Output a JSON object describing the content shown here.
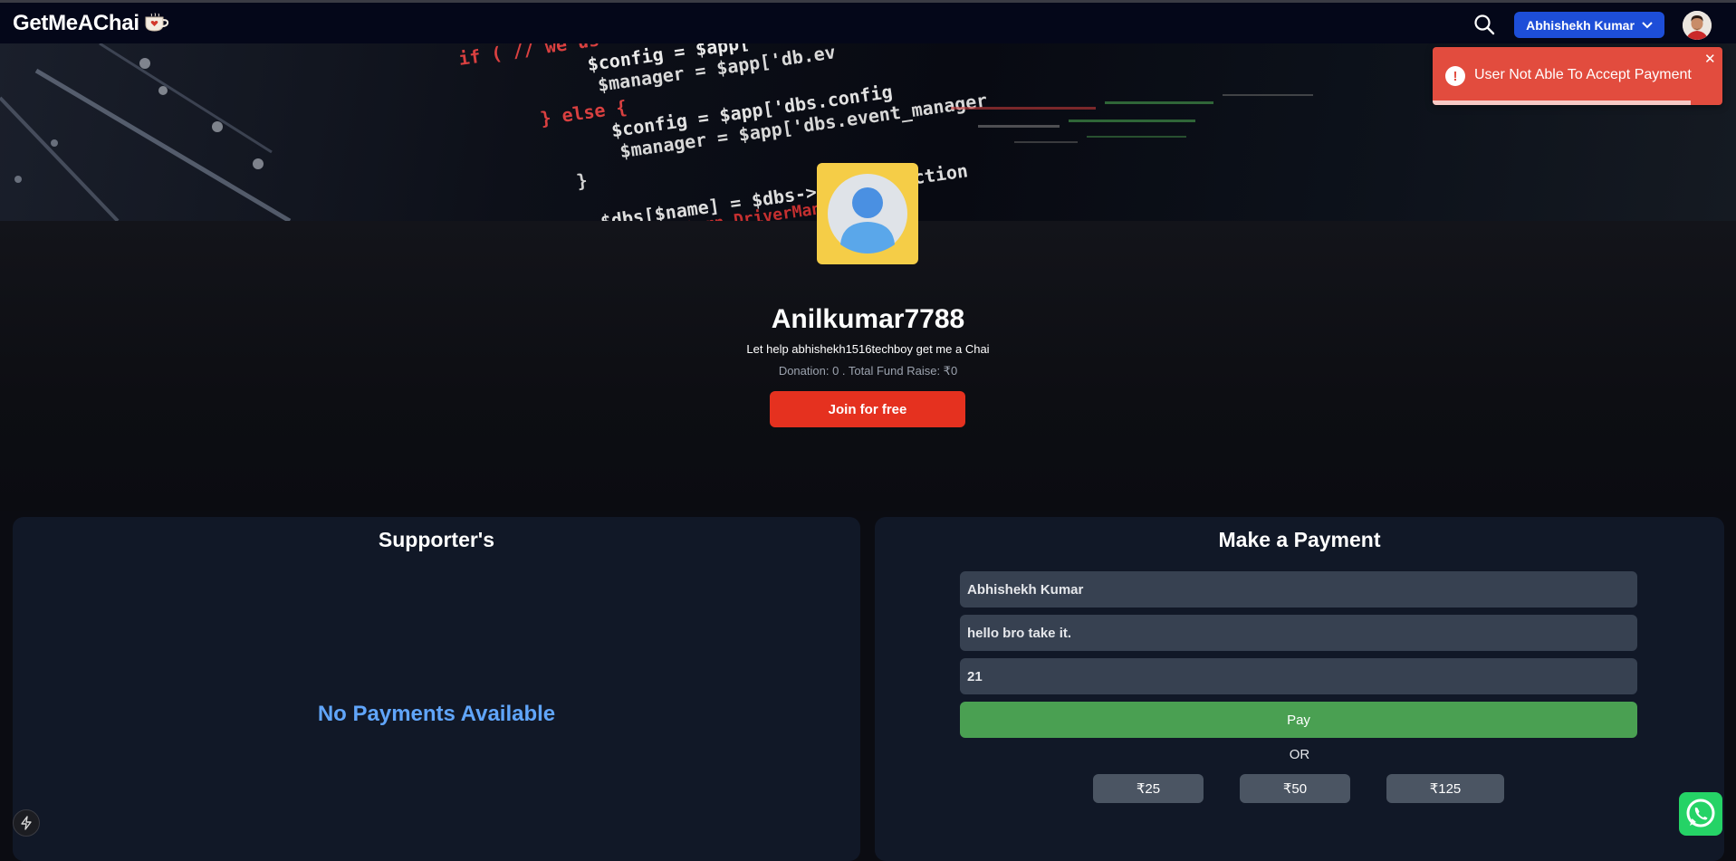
{
  "nav": {
    "logo_text": "GetMeAChai",
    "logo_icon": "chai-cup-icon",
    "search_icon": "search-icon",
    "user_button_label": "Abhishekh Kumar",
    "user_button_icon": "chevron-down-icon",
    "avatar": "avatar"
  },
  "banner": {
    "code_lines": [
      "if ( // we us",
      "$config = $app[",
      "$manager = $app['db.ev",
      "} else {",
      "$config = $app['dbs.config",
      "$manager = $app['dbs.event_manager",
      "}",
      "$dbs[$name] = $dbs->share(function",
      "return DriverManager::",
      "});"
    ]
  },
  "profile": {
    "username": "Anilkumar7788",
    "tagline": "Let help abhishekh1516techboy get me a Chai",
    "stats": "Donation: 0 . Total Fund Raise: ₹0",
    "join_label": "Join for free"
  },
  "supporters": {
    "title": "Supporter's",
    "empty_text": "No Payments Available"
  },
  "payment": {
    "title": "Make a Payment",
    "name_value": "Abhishekh Kumar",
    "message_value": "hello bro take it.",
    "amount_value": "21",
    "pay_label": "Pay",
    "or_label": "OR",
    "quick_amounts": [
      "₹25",
      "₹50",
      "₹125"
    ]
  },
  "toast": {
    "message": "User Not Able To Accept Payment",
    "close": "✕",
    "progress": 0.89
  },
  "colors": {
    "nav_bg": "#040719",
    "user_button": "#1d4ed8",
    "join_button": "#e5311f",
    "pay_button": "#4aa052",
    "toast": "#e24c3e",
    "empty_text": "#60a5fa",
    "panel": "#111827"
  }
}
